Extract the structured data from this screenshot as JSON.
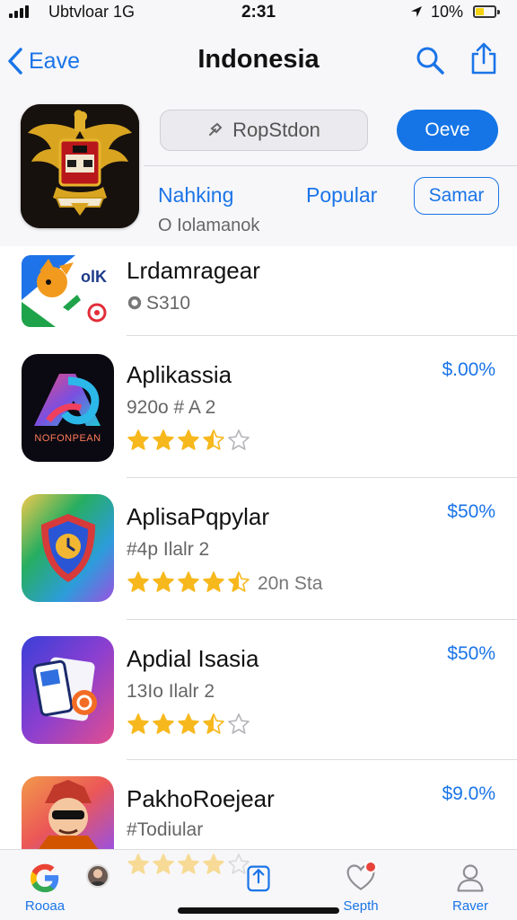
{
  "status_bar": {
    "carrier": "Ubtvloar 1G",
    "time": "2:31",
    "battery": "10%",
    "battery_level": 0.45
  },
  "nav": {
    "back_label": "Eave",
    "title": "Indonesia",
    "search_icon": "search-icon",
    "share_icon": "share-icon"
  },
  "header": {
    "search_placeholder": "RopStdon",
    "get_label": "Oeve",
    "tabs": [
      "Nahking",
      "Popular",
      "Samar"
    ],
    "subtitle": "O Iolamanok"
  },
  "apps": [
    {
      "title": "Lrdamragear",
      "subtitle": "S310",
      "price": "",
      "rating": null,
      "rating_count": ""
    },
    {
      "title": "Aplikassia",
      "subtitle": "920o # A 2",
      "price": "$.00%",
      "rating": 3.5,
      "rating_count": "",
      "icon_text": "NOFONPEAN"
    },
    {
      "title": "AplisaPqpylar",
      "subtitle": "#4p Ilalr 2",
      "price": "$50%",
      "rating": 4.5,
      "rating_count": "20n Sta"
    },
    {
      "title": "Apdial Isasia",
      "subtitle": "13Io Ilalr 2",
      "price": "$50%",
      "rating": 3.5,
      "rating_count": ""
    },
    {
      "title": "PakhoRoejear",
      "subtitle": "#Todiular",
      "price": "$9.0%",
      "rating": 4,
      "rating_count": ""
    }
  ],
  "tab_bar": {
    "items": [
      "Rooaa",
      "",
      "Septh",
      "Raver"
    ]
  },
  "colors": {
    "accent": "#1a74e8",
    "star": "#f7b81d",
    "badge": "#e8433a"
  }
}
